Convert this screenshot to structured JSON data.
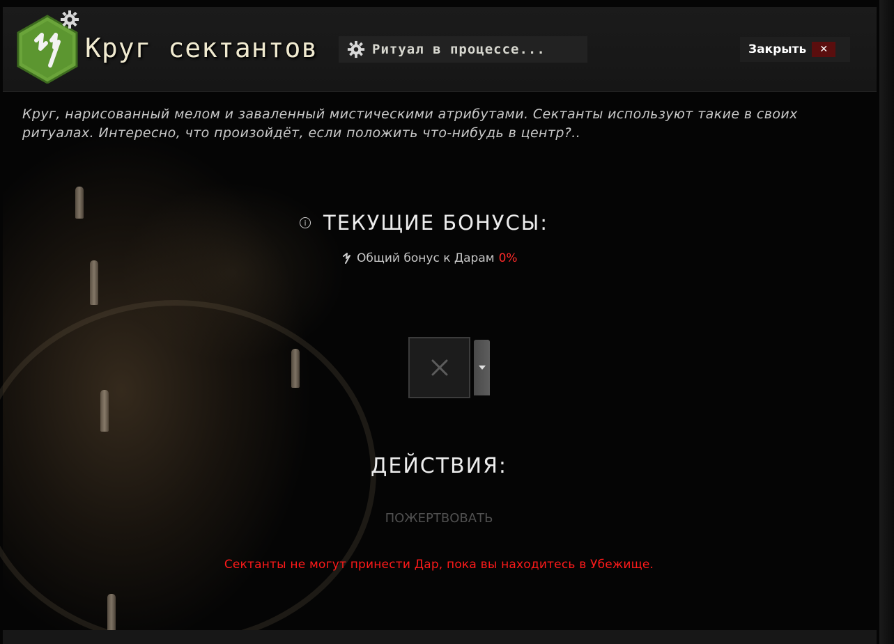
{
  "header": {
    "title": "Круг сектантов",
    "status_text": "Ритуал в процессе...",
    "close_label": "Закрыть",
    "close_glyph": "✕",
    "badge_color": "#6aa43a"
  },
  "description": "Круг, нарисованный мелом и заваленный мистическими атрибутами. Сектанты используют такие в своих ритуалах. Интересно, что произойдёт, если положить что-нибудь в центр?..",
  "bonuses": {
    "heading": "ТЕКУЩИЕ БОНУСЫ:",
    "info_glyph": "i",
    "items": [
      {
        "label": "Общий бонус к Дарам",
        "value": "0%",
        "value_color": "#ff2a2a"
      }
    ]
  },
  "slot": {
    "empty_glyph": "✕",
    "dropdown_glyph": "▾"
  },
  "actions": {
    "heading": "ДЕЙСТВИЯ:",
    "donate_label": "ПОЖЕРТВОВАТЬ",
    "warning": "Сектанты не могут принести Дар, пока вы находитесь в Убежище.",
    "warning_color": "#ff1a1a"
  }
}
